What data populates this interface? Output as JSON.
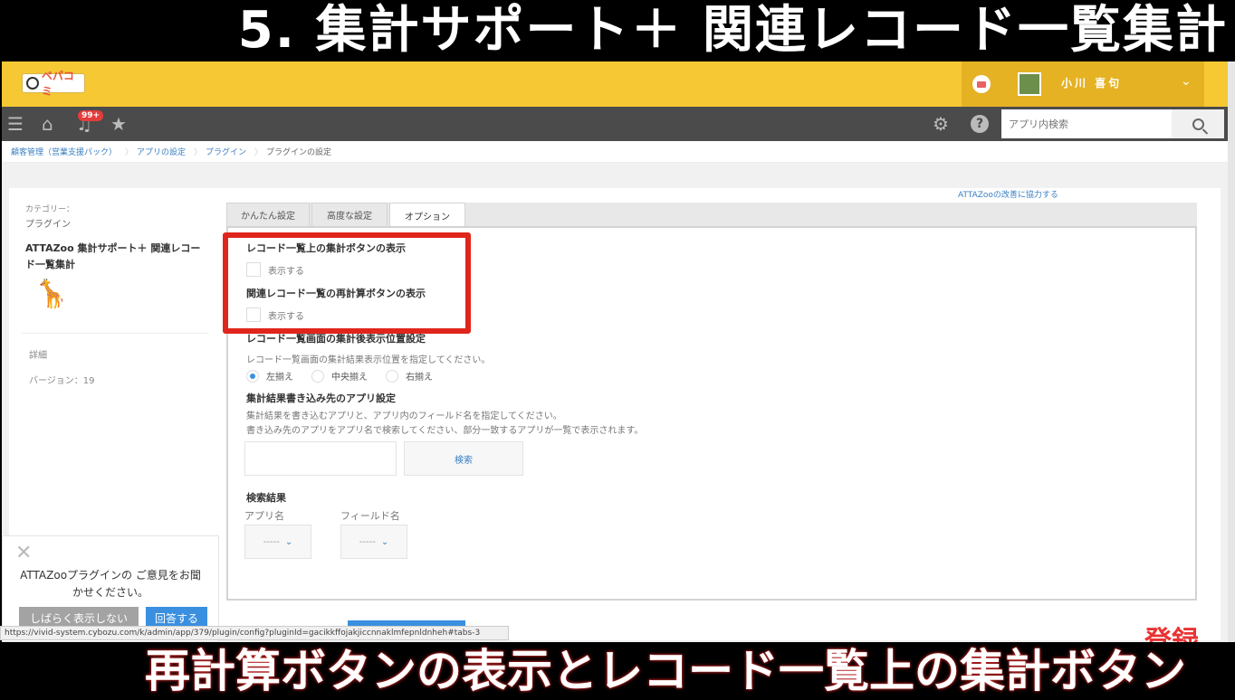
{
  "captions": {
    "top": "5. 集計サポート＋ 関連レコード一覧集計",
    "bottom": "再計算ボタンの表示とレコード一覧上の集計ボタン",
    "subscribe": "登録"
  },
  "header": {
    "logo_text": "ペパコミ",
    "user_name": "小川 喜句",
    "chevron": "⌄"
  },
  "toolbar": {
    "notification_count": "99+",
    "search_placeholder": "アプリ内検索"
  },
  "breadcrumb": [
    "顧客管理（営業支援パック）",
    "アプリの設定",
    "プラグイン",
    "プラグインの設定"
  ],
  "sidebar": {
    "category_label": "カテゴリー：",
    "category_value": "プラグイン",
    "plugin_name": "ATTAZoo 集計サポート＋ 関連レコード一覧集計",
    "detail_label": "詳細",
    "version": "バージョン：19"
  },
  "contribute_link": "ATTAZooの改善に協力する",
  "tabs": [
    "かんたん設定",
    "高度な設定",
    "オプション"
  ],
  "options": {
    "section1_title": "レコード一覧上の集計ボタンの表示",
    "section1_checkbox": "表示する",
    "section2_title": "関連レコード一覧の再計算ボタンの表示",
    "section2_checkbox": "表示する",
    "section3_title": "レコード一覧画面の集計後表示位置設定",
    "section3_desc": "レコード一覧画面の集計結果表示位置を指定してください。",
    "align_options": [
      "左揃え",
      "中央揃え",
      "右揃え"
    ],
    "section4_title": "集計結果書き込み先のアプリ設定",
    "section4_desc1": "集計結果を書き込むアプリと、アプリ内のフィールド名を指定してください。",
    "section4_desc2": "書き込み先のアプリをアプリ名で検索してください、部分一致するアプリが一覧で表示されます。",
    "search_button": "検索",
    "results_title": "検索結果",
    "app_name_label": "アプリ名",
    "field_name_label": "フィールド名",
    "select_placeholder": "-----"
  },
  "feedback": {
    "message": "ATTAZooプラグインの ご意見をお聞かせください。",
    "later_button": "しばらく表示しない",
    "answer_button": "回答する"
  },
  "status_url": "https://vivid-system.cybozu.com/k/admin/app/379/plugin/config?pluginId=gacikkffojakjiccnnaklmfepnldnheh#tabs-3"
}
